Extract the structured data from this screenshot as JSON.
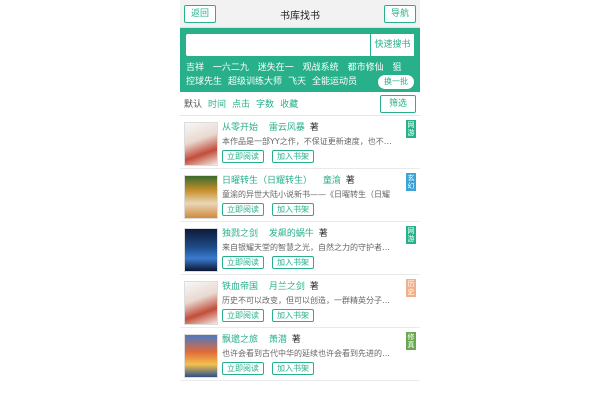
{
  "topbar": {
    "back_label": "返回",
    "title": "书库找书",
    "nav_label": "导航"
  },
  "search": {
    "placeholder": "",
    "button_label": "快速搜书"
  },
  "hot_words_row1": [
    "吉祥",
    "一六二九",
    "迷失在一",
    "观战系统",
    "都市修仙",
    "狙"
  ],
  "hot_words_row2": [
    "控球先生",
    "超级训练大师",
    "飞天",
    "全能运动员"
  ],
  "swap_label": "换一批",
  "sort": {
    "items": [
      "默认",
      "时间",
      "点击",
      "字数",
      "收藏"
    ],
    "filter_label": "筛选"
  },
  "actions": {
    "read": "立即阅读",
    "shelf": "加入书架"
  },
  "books": [
    {
      "title": "从零开始",
      "author": "雷云风暴",
      "zhu": "著",
      "desc": "本作品是一部YY之作，不保证更新速度，也不…",
      "tag": "网游",
      "tag_color": "#27b08a"
    },
    {
      "title": "日曜转生（日耀转生）",
      "author": "童渝",
      "zhu": "著",
      "desc": "童渝的异世大陆小说新书——《日曜转生（日耀",
      "tag": "玄幻",
      "tag_color": "#3aa3d8"
    },
    {
      "title": "独戮之剑",
      "author": "发飙的蜗牛",
      "zhu": "著",
      "desc": "来自银耀天堂的智慧之光，自然之力的守护者…",
      "tag": "网游",
      "tag_color": "#27b08a"
    },
    {
      "title": "铁血帝国",
      "author": "月兰之剑",
      "zhu": "著",
      "desc": "历史不可以改变，但可以创造，一群精英分子…",
      "tag": "历史",
      "tag_color": "#f0b08a"
    },
    {
      "title": "飘邈之旅",
      "author": "萧潜",
      "zhu": "著",
      "desc": "也许会看到古代中华的延续也许会看到先进的…",
      "tag": "修真",
      "tag_color": "#6aa84f"
    }
  ]
}
